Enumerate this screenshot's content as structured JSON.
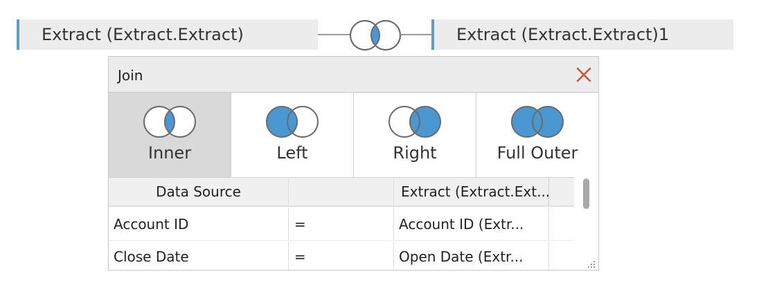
{
  "top_bar": {
    "left_source": "Extract (Extract.Extract)",
    "right_source": "Extract (Extract.Extract)1",
    "join_icon": "inner-join-venn-icon"
  },
  "dialog": {
    "title": "Join",
    "close_icon": "close-icon",
    "join_types": [
      {
        "label": "Inner",
        "icon": "inner-join-icon",
        "selected": true
      },
      {
        "label": "Left",
        "icon": "left-join-icon",
        "selected": false
      },
      {
        "label": "Right",
        "icon": "right-join-icon",
        "selected": false
      },
      {
        "label": "Full Outer",
        "icon": "full-outer-join-icon",
        "selected": false
      }
    ],
    "grid": {
      "headers": [
        "Data Source",
        "",
        "Extract (Extract.Ext..."
      ],
      "rows": [
        {
          "left": "Account ID",
          "op": "=",
          "right": "Account ID (Extr..."
        },
        {
          "left": "Close Date",
          "op": "=",
          "right": "Open Date (Extr..."
        }
      ]
    }
  },
  "colors": {
    "accent": "#4a97d1",
    "circle_stroke": "#6b6b6b",
    "close": "#c8533a",
    "pill_border": "#5b9ec7"
  }
}
